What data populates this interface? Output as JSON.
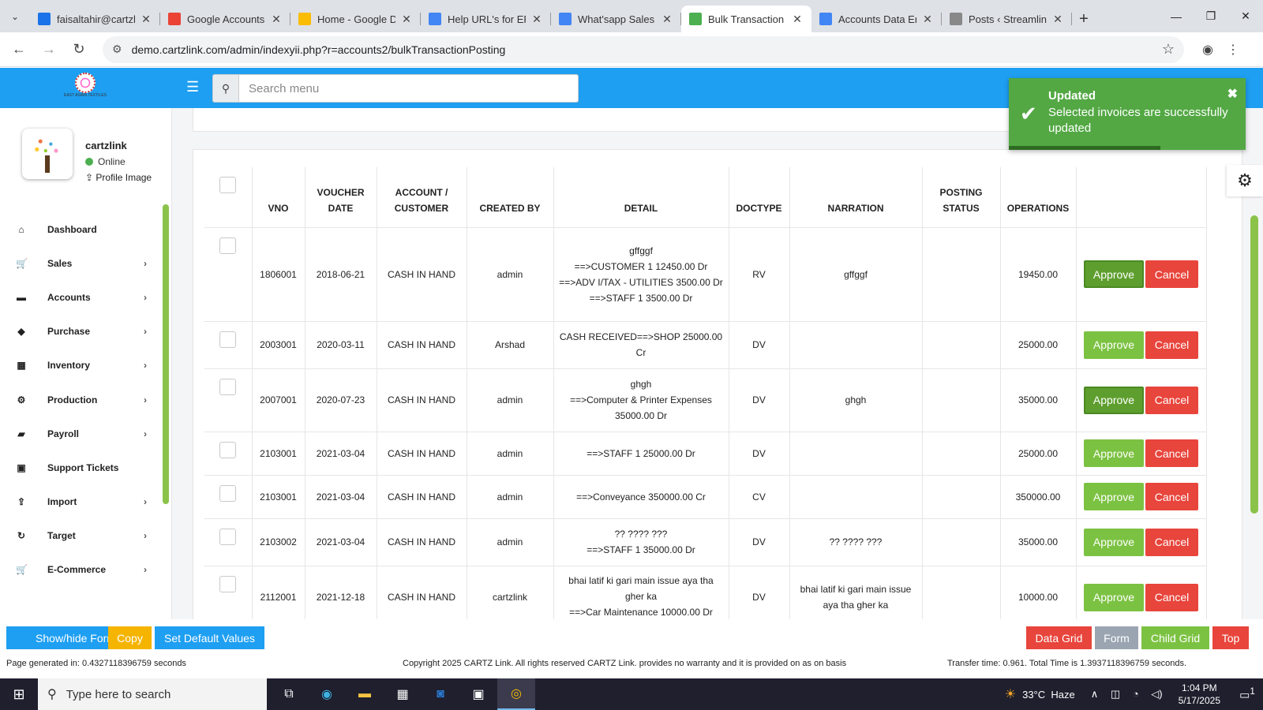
{
  "browser": {
    "tabs": [
      {
        "title": "faisaltahir@cartzli",
        "color": "#1a73e8"
      },
      {
        "title": "Google Accounts",
        "color": "#ea4335"
      },
      {
        "title": "Home - Google D",
        "color": "#fbbc04"
      },
      {
        "title": "Help URL's for ERP",
        "color": "#4285f4"
      },
      {
        "title": "What'sapp Sales M",
        "color": "#4285f4"
      },
      {
        "title": "Bulk Transaction P",
        "color": "#4caf50"
      },
      {
        "title": "Accounts Data Ent",
        "color": "#4285f4"
      },
      {
        "title": "Posts ‹ Streamline",
        "color": "#888888"
      }
    ],
    "url": "demo.cartzlink.com/admin/indexyii.php?r=accounts2/bulkTransactionPosting"
  },
  "header": {
    "logo_text": "EAST ASIAN TEXTILES",
    "search_placeholder": "Search menu"
  },
  "sidebar": {
    "user_name": "cartzlink",
    "user_status": "Online",
    "profile_image_label": "Profile Image",
    "items": [
      {
        "label": "Dashboard",
        "icon": "home-icon",
        "glyph": "⌂",
        "arrow": ""
      },
      {
        "label": "Sales",
        "icon": "cart-icon",
        "glyph": "🛒",
        "arrow": "›"
      },
      {
        "label": "Accounts",
        "icon": "briefcase-icon",
        "glyph": "▬",
        "arrow": "›"
      },
      {
        "label": "Purchase",
        "icon": "tag-icon",
        "glyph": "◆",
        "arrow": "›"
      },
      {
        "label": "Inventory",
        "icon": "grid-icon",
        "glyph": "▦",
        "arrow": "›"
      },
      {
        "label": "Production",
        "icon": "cogs-icon",
        "glyph": "⚙",
        "arrow": "›"
      },
      {
        "label": "Payroll",
        "icon": "money-icon",
        "glyph": "▰",
        "arrow": "›"
      },
      {
        "label": "Support Tickets",
        "icon": "ticket-icon",
        "glyph": "▣",
        "arrow": ""
      },
      {
        "label": "Import",
        "icon": "upload-icon",
        "glyph": "⇪",
        "arrow": "›"
      },
      {
        "label": "Target",
        "icon": "refresh-icon",
        "glyph": "↻",
        "arrow": "›"
      },
      {
        "label": "E-Commerce",
        "icon": "cart-icon",
        "glyph": "🛒",
        "arrow": "›"
      }
    ]
  },
  "table": {
    "headers": {
      "vno": "VNO",
      "voucher_date": "VOUCHER DATE",
      "account": "ACCOUNT / CUSTOMER",
      "created_by": "CREATED BY",
      "detail": "DETAIL",
      "doctype": "DOCTYPE",
      "narration": "NARRATION",
      "posting_status": "POSTING STATUS",
      "operations": "OPERATIONS"
    },
    "approve_label": "Approve",
    "cancel_label": "Cancel",
    "rows": [
      {
        "vno": "1806001",
        "date": "2018-06-21",
        "account": "CASH IN HAND",
        "created_by": "admin",
        "detail": [
          "gffggf",
          "==>CUSTOMER 1 12450.00 Dr",
          "==>ADV I/TAX - UTILITIES 3500.00 Dr",
          "==>STAFF 1 3500.00 Dr"
        ],
        "doctype": "RV",
        "narration": "gffggf",
        "posting_status": "",
        "amount": "19450.00",
        "approve_style": "dark"
      },
      {
        "vno": "2003001",
        "date": "2020-03-11",
        "account": "CASH IN HAND",
        "created_by": "Arshad",
        "detail": [
          "CASH RECEIVED==>SHOP 25000.00 Cr"
        ],
        "doctype": "DV",
        "narration": "",
        "posting_status": "",
        "amount": "25000.00",
        "approve_style": "normal"
      },
      {
        "vno": "2007001",
        "date": "2020-07-23",
        "account": "CASH IN HAND",
        "created_by": "admin",
        "detail": [
          "ghgh",
          "==>Computer & Printer Expenses 35000.00 Dr"
        ],
        "doctype": "DV",
        "narration": "ghgh",
        "posting_status": "",
        "amount": "35000.00",
        "approve_style": "dark"
      },
      {
        "vno": "2103001",
        "date": "2021-03-04",
        "account": "CASH IN HAND",
        "created_by": "admin",
        "detail": [
          "==>STAFF 1 25000.00 Dr"
        ],
        "doctype": "DV",
        "narration": "",
        "posting_status": "",
        "amount": "25000.00",
        "approve_style": "normal"
      },
      {
        "vno": "2103001",
        "date": "2021-03-04",
        "account": "CASH IN HAND",
        "created_by": "admin",
        "detail": [
          "==>Conveyance 350000.00 Cr"
        ],
        "doctype": "CV",
        "narration": "",
        "posting_status": "",
        "amount": "350000.00",
        "approve_style": "normal"
      },
      {
        "vno": "2103002",
        "date": "2021-03-04",
        "account": "CASH IN HAND",
        "created_by": "admin",
        "detail": [
          "?? ???? ???",
          "==>STAFF 1 35000.00 Dr"
        ],
        "doctype": "DV",
        "narration": "?? ???? ???",
        "posting_status": "",
        "amount": "35000.00",
        "approve_style": "normal"
      },
      {
        "vno": "2112001",
        "date": "2021-12-18",
        "account": "CASH IN HAND",
        "created_by": "cartzlink",
        "detail": [
          "bhai latif ki gari main issue aya tha gher ka",
          "==>Car Maintenance 10000.00 Dr"
        ],
        "doctype": "DV",
        "narration": "bhai latif ki gari main issue aya tha gher ka",
        "posting_status": "",
        "amount": "10000.00",
        "approve_style": "normal"
      }
    ]
  },
  "toast": {
    "title": "Updated",
    "message": "Selected invoices are successfully updated",
    "progress": 0.64,
    "color": "#53a844"
  },
  "bottom_buttons": {
    "show_hide_form": "Show/hide Form",
    "copy": "Copy",
    "set_default": "Set Default Values",
    "data_grid": "Data Grid",
    "form": "Form",
    "child_grid": "Child Grid",
    "top": "Top"
  },
  "footer": {
    "page_generated": "Page generated in: 0.4327118396759 seconds",
    "copyright": "Copyright 2025 CARTZ Link. All rights reserved CARTZ Link. provides no warranty and it is provided on as on basis",
    "transfer_time": "Transfer time: 0.961. Total Time is 1.3937118396759 seconds."
  },
  "taskbar": {
    "search_placeholder": "Type here to search",
    "temperature": "33°C",
    "weather": "Haze",
    "time": "1:04 PM",
    "date": "5/17/2025",
    "notification_count": "1"
  }
}
